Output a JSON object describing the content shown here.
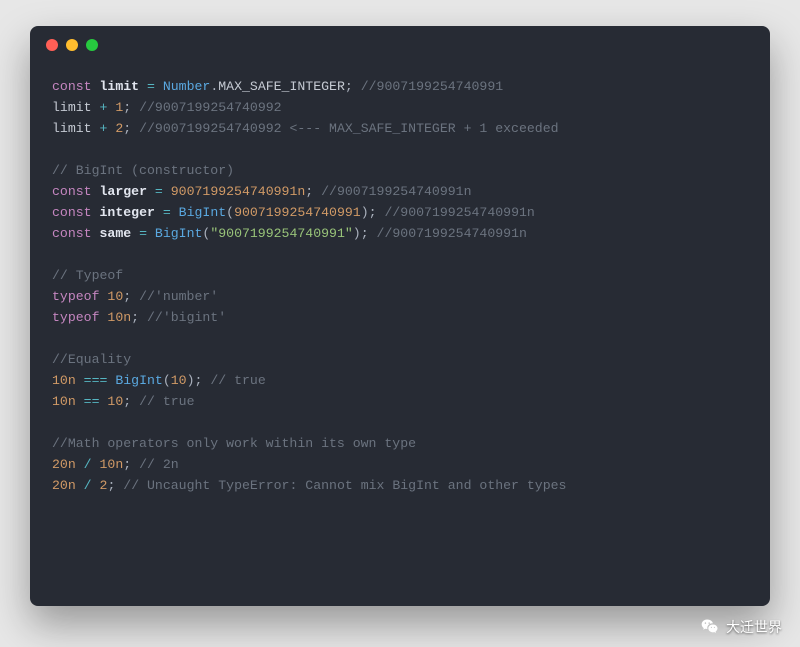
{
  "colors": {
    "page_bg": "#e7e7e7",
    "terminal_bg": "#272b34",
    "dot_red": "#ff5f56",
    "dot_yellow": "#ffbd2e",
    "dot_green": "#27c93f",
    "keyword": "#c586c0",
    "function": "#5aa8e0",
    "identifier": "#e2e6ef",
    "number": "#d19a66",
    "string": "#98c379",
    "operator": "#56b6c2",
    "comment": "#6b737f"
  },
  "watermark": {
    "label": "大迁世界"
  },
  "code": {
    "l1": {
      "kw": "const",
      "id": "limit",
      "eq": "=",
      "obj": "Number",
      "dot": ".",
      "prop": "MAX_SAFE_INTEGER",
      "semi": ";",
      "com": "//9007199254740991"
    },
    "l2": {
      "id": "limit",
      "op": "+",
      "num": "1",
      "semi": ";",
      "com": "//9007199254740992"
    },
    "l3": {
      "id": "limit",
      "op": "+",
      "num": "2",
      "semi": ";",
      "com": "//9007199254740992 <--- MAX_SAFE_INTEGER + 1 exceeded"
    },
    "l5": {
      "com": "// BigInt (constructor)"
    },
    "l6": {
      "kw": "const",
      "id": "larger",
      "eq": "=",
      "num": "9007199254740991n",
      "semi": ";",
      "com": "//9007199254740991n"
    },
    "l7": {
      "kw": "const",
      "id": "integer",
      "eq": "=",
      "fn": "BigInt",
      "lp": "(",
      "arg": "9007199254740991",
      "rp": ")",
      "semi": ";",
      "com": "//9007199254740991n"
    },
    "l8": {
      "kw": "const",
      "id": "same",
      "eq": "=",
      "fn": "BigInt",
      "lp": "(",
      "arg": "\"9007199254740991\"",
      "rp": ")",
      "semi": ";",
      "com": "//9007199254740991n"
    },
    "l10": {
      "com": "// Typeof"
    },
    "l11": {
      "kw": "typeof",
      "num": "10",
      "semi": ";",
      "com": "//'number'"
    },
    "l12": {
      "kw": "typeof",
      "num": "10n",
      "semi": ";",
      "com": "//'bigint'"
    },
    "l14": {
      "com": "//Equality"
    },
    "l15": {
      "lhs": "10n",
      "op": "===",
      "fn": "BigInt",
      "lp": "(",
      "arg": "10",
      "rp": ")",
      "semi": ";",
      "com": "// true"
    },
    "l16": {
      "lhs": "10n",
      "op": "==",
      "rhs": "10",
      "semi": ";",
      "com": "// true"
    },
    "l18": {
      "com": "//Math operators only work within its own type"
    },
    "l19": {
      "lhs": "20n",
      "op": "/",
      "rhs": "10n",
      "semi": ";",
      "com": "// 2n"
    },
    "l20": {
      "lhs": "20n",
      "op": "/",
      "rhs": "2",
      "semi": ";",
      "com": "// Uncaught TypeError: Cannot mix BigInt and other types"
    }
  }
}
